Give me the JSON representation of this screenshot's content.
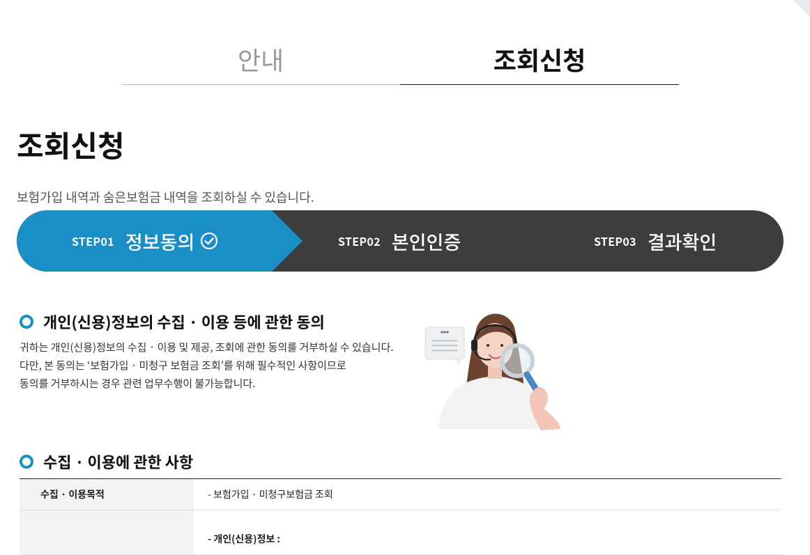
{
  "tabs": [
    {
      "label": "안내",
      "active": false
    },
    {
      "label": "조회신청",
      "active": true
    }
  ],
  "page": {
    "title": "조회신청",
    "description": "보험가입 내역과 숨은보험금 내역을 조회하실 수 있습니다."
  },
  "steps": [
    {
      "num": "STEP01",
      "name": "정보동의",
      "status": "current"
    },
    {
      "num": "STEP02",
      "name": "본인인증",
      "status": "pending"
    },
    {
      "num": "STEP03",
      "name": "결과확인",
      "status": "pending"
    }
  ],
  "colors": {
    "accent": "#1a8fc6",
    "stepbar_dark": "#3d3d3d"
  },
  "consent": {
    "heading": "개인(신용)정보의 수집 · 이용 등에 관한 동의",
    "lines": [
      "귀하는 개인(신용)정보의 수집 · 이용 및 제공, 조회에 관한 동의를 거부하실 수 있습니다.",
      "다만, 본 동의는 ‘보험가입 · 미청구 보험금 조회’를 위해 필수적인 사항이므로",
      "동의를 거부하시는 경우 관련 업무수행이 불가능합니다."
    ]
  },
  "collection": {
    "heading": "수집 · 이용에 관한 사항",
    "rows": [
      {
        "header": "수집 · 이용목적",
        "value": "- 보험가입 · 미청구보험금 조회"
      },
      {
        "header": "",
        "value": "- 개인(신용)정보 :"
      }
    ]
  }
}
